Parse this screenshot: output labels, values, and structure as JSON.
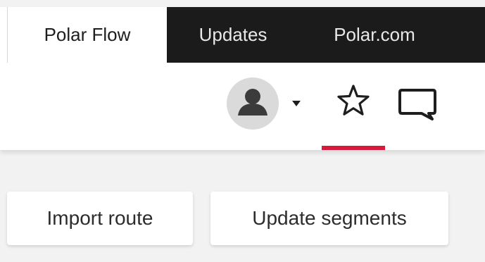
{
  "tabs": [
    {
      "label": "Polar Flow",
      "active": true
    },
    {
      "label": "Updates",
      "active": false
    },
    {
      "label": "Polar.com",
      "active": false
    }
  ],
  "header": {
    "icons": [
      "avatar-icon",
      "caret-down-icon",
      "star-icon",
      "chat-icon"
    ],
    "accent_color": "#d7193b"
  },
  "actions": {
    "import_route": "Import route",
    "update_segments": "Update segments"
  }
}
